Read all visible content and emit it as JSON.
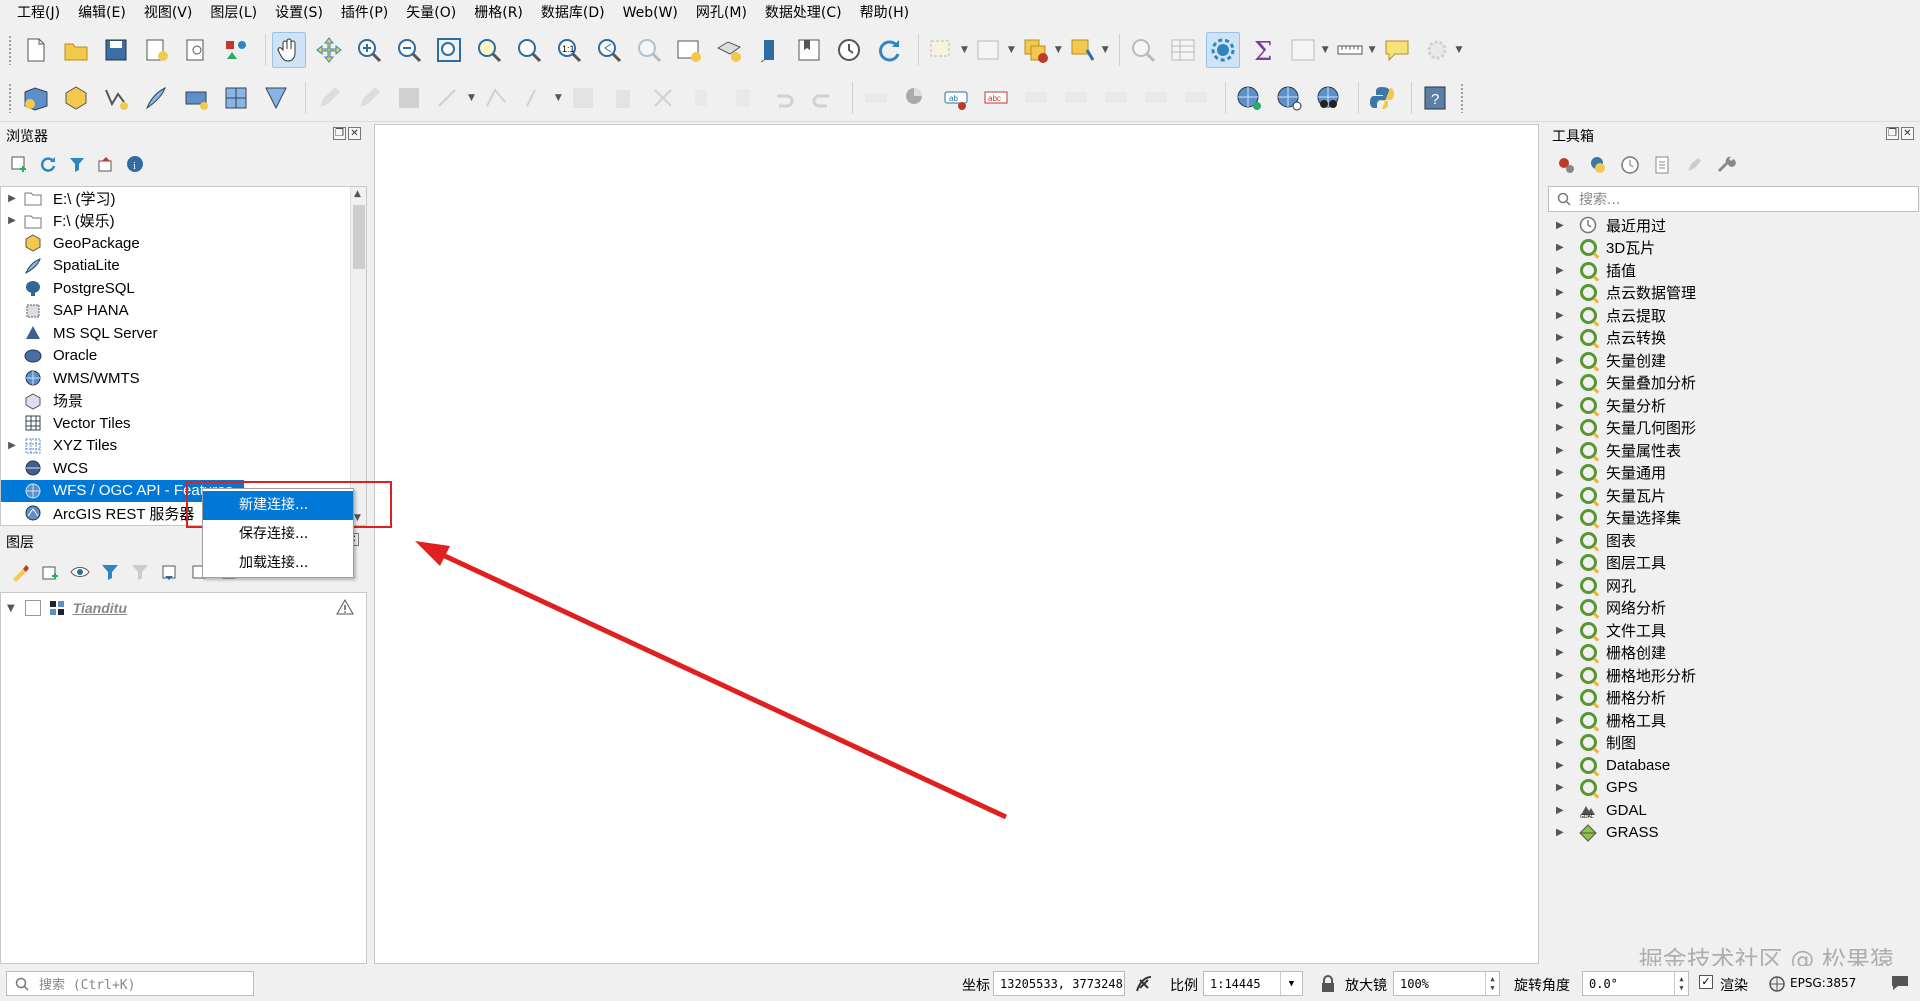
{
  "menu": [
    "工程(J)",
    "编辑(E)",
    "视图(V)",
    "图层(L)",
    "设置(S)",
    "插件(P)",
    "矢量(O)",
    "栅格(R)",
    "数据库(D)",
    "Web(W)",
    "网孔(M)",
    "数据处理(C)",
    "帮助(H)"
  ],
  "browser": {
    "title": "浏览器",
    "items": [
      {
        "label": "E:\\ (学习)",
        "icon": "folder-icon",
        "expandable": true
      },
      {
        "label": "F:\\ (娱乐)",
        "icon": "folder-icon",
        "expandable": true
      },
      {
        "label": "GeoPackage",
        "icon": "geopackage-icon",
        "expandable": false
      },
      {
        "label": "SpatiaLite",
        "icon": "spatialite-icon",
        "expandable": false
      },
      {
        "label": "PostgreSQL",
        "icon": "postgresql-icon",
        "expandable": false
      },
      {
        "label": "SAP HANA",
        "icon": "sap-hana-icon",
        "expandable": false
      },
      {
        "label": "MS SQL Server",
        "icon": "mssql-icon",
        "expandable": false
      },
      {
        "label": "Oracle",
        "icon": "oracle-icon",
        "expandable": false
      },
      {
        "label": "WMS/WMTS",
        "icon": "wms-icon",
        "expandable": false
      },
      {
        "label": "场景",
        "icon": "scene-icon",
        "expandable": false
      },
      {
        "label": "Vector Tiles",
        "icon": "vector-tiles-icon",
        "expandable": false
      },
      {
        "label": "XYZ Tiles",
        "icon": "xyz-tiles-icon",
        "expandable": true
      },
      {
        "label": "WCS",
        "icon": "wcs-icon",
        "expandable": false
      },
      {
        "label": "WFS / OGC API - Features",
        "icon": "wfs-icon",
        "expandable": false
      },
      {
        "label": "ArcGIS REST 服务器",
        "icon": "arcgis-icon",
        "expandable": false
      }
    ]
  },
  "context_menu": {
    "items": [
      "新建连接...",
      "保存连接...",
      "加载连接..."
    ],
    "highlighted": 0
  },
  "layers": {
    "title": "图层",
    "items": [
      {
        "label": "Tianditu"
      }
    ]
  },
  "toolbox": {
    "title": "工具箱",
    "search_placeholder": "搜索...",
    "items": [
      {
        "label": "最近用过",
        "icon": "clock-icon"
      },
      {
        "label": "3D瓦片",
        "icon": "qgis-icon"
      },
      {
        "label": "插值",
        "icon": "qgis-icon"
      },
      {
        "label": "点云数据管理",
        "icon": "qgis-icon"
      },
      {
        "label": "点云提取",
        "icon": "qgis-icon"
      },
      {
        "label": "点云转换",
        "icon": "qgis-icon"
      },
      {
        "label": "矢量创建",
        "icon": "qgis-icon"
      },
      {
        "label": "矢量叠加分析",
        "icon": "qgis-icon"
      },
      {
        "label": "矢量分析",
        "icon": "qgis-icon"
      },
      {
        "label": "矢量几何图形",
        "icon": "qgis-icon"
      },
      {
        "label": "矢量属性表",
        "icon": "qgis-icon"
      },
      {
        "label": "矢量通用",
        "icon": "qgis-icon"
      },
      {
        "label": "矢量瓦片",
        "icon": "qgis-icon"
      },
      {
        "label": "矢量选择集",
        "icon": "qgis-icon"
      },
      {
        "label": "图表",
        "icon": "qgis-icon"
      },
      {
        "label": "图层工具",
        "icon": "qgis-icon"
      },
      {
        "label": "网孔",
        "icon": "qgis-icon"
      },
      {
        "label": "网络分析",
        "icon": "qgis-icon"
      },
      {
        "label": "文件工具",
        "icon": "qgis-icon"
      },
      {
        "label": "栅格创建",
        "icon": "qgis-icon"
      },
      {
        "label": "栅格地形分析",
        "icon": "qgis-icon"
      },
      {
        "label": "栅格分析",
        "icon": "qgis-icon"
      },
      {
        "label": "栅格工具",
        "icon": "qgis-icon"
      },
      {
        "label": "制图",
        "icon": "qgis-icon"
      },
      {
        "label": "Database",
        "icon": "qgis-icon"
      },
      {
        "label": "GPS",
        "icon": "qgis-icon"
      },
      {
        "label": "GDAL",
        "icon": "gdal-icon"
      },
      {
        "label": "GRASS",
        "icon": "grass-icon"
      }
    ]
  },
  "statusbar": {
    "search_placeholder": "搜索 (Ctrl+K)",
    "coord_label": "坐标",
    "coord_value": "13205533, 3773248",
    "scale_label": "比例",
    "scale_value": "1:14445",
    "magnifier_label": "放大镜",
    "magnifier_value": "100%",
    "rotation_label": "旋转角度",
    "rotation_value": "0.0°",
    "render_label": "渲染",
    "crs": "EPSG:3857"
  },
  "watermark": "掘金技术社区 @ 松果猿",
  "colors": {
    "selection": "#0078d7",
    "annotation_red": "#e02020",
    "qgis_green": "#589632"
  }
}
